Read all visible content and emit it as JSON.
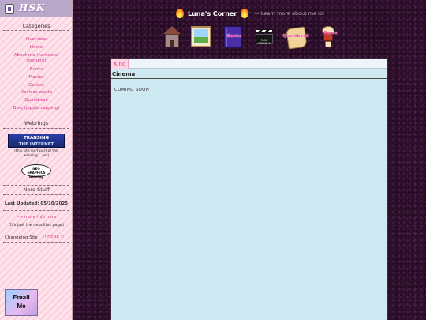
{
  "sidebar": {
    "logo_text": "HSK",
    "categories_title": "Categories",
    "nav_items": [
      "Overview",
      "Home",
      "About me (narcissist moment)",
      "Books",
      "Movies",
      "Gallery",
      "Devices woeto",
      "Questbook",
      "Blog (pipple zapping)"
    ],
    "webrings_title": "Webrings",
    "webring_banner": [
      "TRANSING",
      "THE INTERNET"
    ],
    "webring_note": "(this site isn't part of the webring... yet)",
    "neocities_badge": [
      "NEO",
      "GRAPHICS",
      "webring"
    ],
    "nerd_title": "Nerd Stuff",
    "last_updated": "Last Updated: 05/10/2025",
    "more_info_link": "--> more info here",
    "more_info_note": "(it's just the neocities page)",
    "changelog_label": "Changelog Site",
    "changelog_link": "!! HERE !!",
    "email_button": [
      "Email",
      "Me"
    ]
  },
  "header": {
    "site_name": "Luna's Corner",
    "tagline": "— Learn more about me lol"
  },
  "icon_nav": {
    "book_label": "Books",
    "clapper_text": "TAKE SCENE 1",
    "scroll_label": "Questbook",
    "cup_label": "Rules"
  },
  "main": {
    "tab_label": "Kino",
    "section_title": "Cinema",
    "body_text": "COMING SOON"
  }
}
